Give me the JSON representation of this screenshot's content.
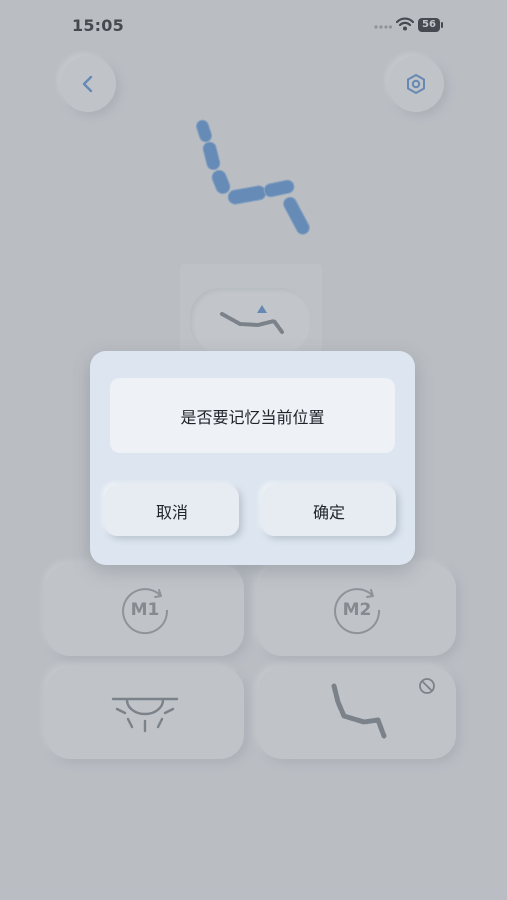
{
  "status_bar": {
    "time": "15:05",
    "battery": "56"
  },
  "icons": {
    "back": "chevron-left-icon",
    "settings": "hexagon-gear-icon",
    "memory_1": "m1-memory-icon",
    "memory_2": "m2-memory-icon",
    "light": "sunrise-light-icon",
    "flat_mode": "reclined-chair-icon",
    "disabled": "forbidden-icon"
  },
  "tiles": {
    "m1_label": "M1",
    "m2_label": "M2"
  },
  "colors": {
    "accent": "#5b8fcb",
    "chair_blue": "#5b92cf",
    "background": "#dcdfe3"
  },
  "dialog": {
    "message": "是否要记忆当前位置",
    "cancel_label": "取消",
    "confirm_label": "确定"
  }
}
